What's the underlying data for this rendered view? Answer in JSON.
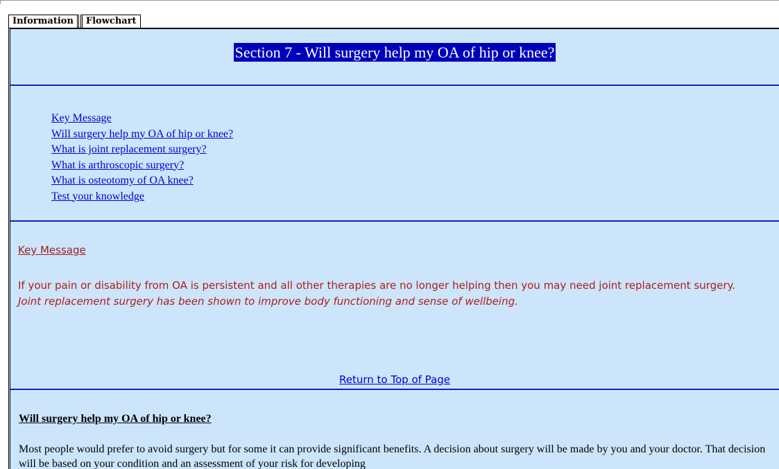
{
  "tabs": [
    {
      "label": "Information",
      "active": true
    },
    {
      "label": "Flowchart",
      "active": false
    }
  ],
  "section_title": "Section 7 - Will surgery help my OA of hip or knee?",
  "toc": [
    "Key Message",
    "Will surgery help my OA of hip or knee?",
    "What is joint replacement surgery?",
    "What is arthroscopic surgery?",
    "What is osteotomy of OA knee?",
    "Test your knowledge"
  ],
  "key_message": {
    "heading": "Key Message",
    "body": "If your pain or disability from OA is persistent and all other therapies are no longer helping then you may need joint replacement surgery.",
    "italic": "Joint replacement surgery has been shown to improve body functioning and sense of wellbeing."
  },
  "return_top_label": "Return to Top of Page",
  "will_surgery": {
    "heading": "Will surgery help my OA of hip or knee?",
    "body": "Most people would prefer to avoid surgery but for some it can provide significant benefits. A decision about surgery will be made by you and your doctor. That decision will be based on your condition and an assessment of your risk for developing"
  },
  "colors": {
    "panel_bg": "#cce5fb",
    "title_bg": "#0000b8",
    "rule": "#1b1bbf",
    "link": "#0000c8",
    "key_text": "#b01c1c"
  }
}
